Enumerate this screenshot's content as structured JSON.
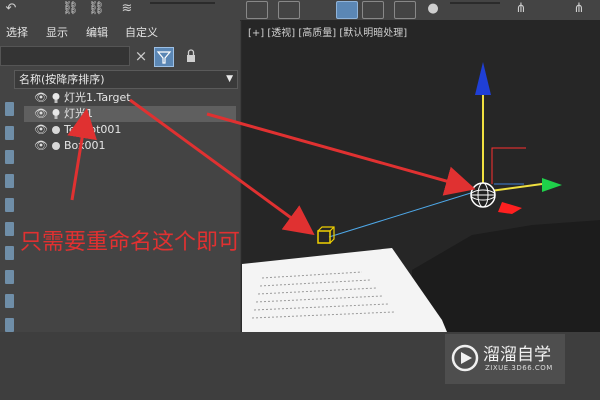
{
  "menu": {
    "items": [
      "选择",
      "显示",
      "编辑",
      "自定义"
    ]
  },
  "outliner": {
    "sort_header": "名称(按降序排序)",
    "rows": [
      {
        "name": "灯光1.Target",
        "type": "light"
      },
      {
        "name": "灯光1",
        "type": "light",
        "selected": true
      },
      {
        "name": "Teapot001",
        "type": "object"
      },
      {
        "name": "Box001",
        "type": "object"
      }
    ]
  },
  "viewport": {
    "label": "[+] [透视] [高质量] [默认明暗处理]"
  },
  "annotation": {
    "text": "只需要重命名这个即可",
    "color": "#e03131"
  },
  "watermark": {
    "title": "溜溜自学",
    "subtitle": "ZIXUE.3D66.COM"
  },
  "colors": {
    "axis_z": "#1f3fd6",
    "axis_x": "#ff2020",
    "axis_y": "#1fd04a",
    "gizmo_light": "#f0e040",
    "target_box": "#f0d000"
  }
}
